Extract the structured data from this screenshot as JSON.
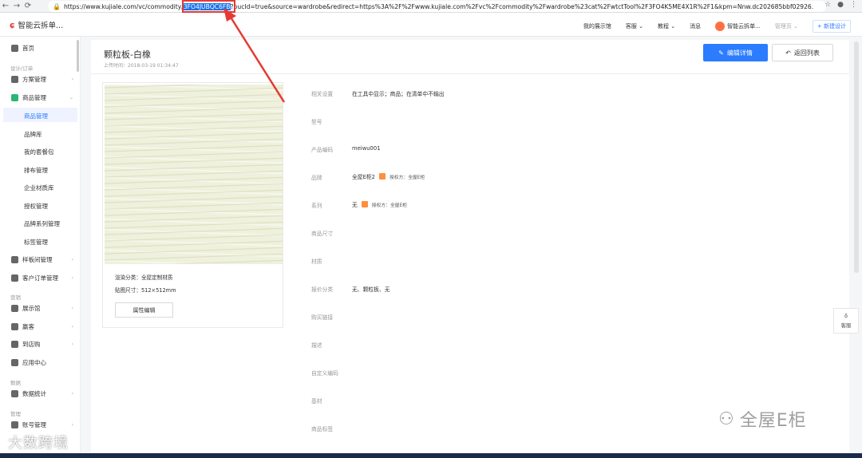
{
  "browser": {
    "url_prefix": "https://www.kujiale.com/vc/commodity/",
    "url_highlight": "3FO4JUBQC6FB",
    "url_suffix": "?bucId=true&source=wardrobe&redirect=https%3A%2F%2Fwww.kujiale.com%2Fvc%2Fcommodity%2Fwardrobe%23cat%2FwtctTool%2F3FO4K5ME4X1R%2F1&kpm=Nnw.dc202685bbf02926."
  },
  "header": {
    "app_name": "智能云拆单...",
    "nav": [
      "我的展示馆",
      "客服",
      "教程",
      "消息"
    ],
    "user_name": "智能云拆单...",
    "admin_page": "管理页",
    "new_design": "+ 新建设计"
  },
  "sidebar": {
    "home": "首页",
    "group_design": "设计/订单",
    "items": [
      "方案管理",
      "商品管理"
    ],
    "sub_items": [
      "商品管理",
      "品牌库",
      "我的套餐包",
      "排布管理",
      "企业材质库",
      "授权管理",
      "品牌系列管理",
      "标签管理"
    ],
    "items2": [
      "样板间管理",
      "客户订单管理"
    ],
    "group_marketing": "营销",
    "marketing_items": [
      "展示馆",
      "赢客",
      "到店购",
      "应用中心"
    ],
    "group_data": "数据",
    "data_items": [
      "数据统计"
    ],
    "group_manage": "管理",
    "manage_items": [
      "账号管理"
    ]
  },
  "main": {
    "title": "颗粒板-白橡",
    "upload_time": "上传时间：2018-03-19 01:34:47",
    "edit_button": "编辑详情",
    "back_button": "返回列表",
    "card": {
      "render_category": "渲染分类：全屋定制材质",
      "texture_size": "贴图尺寸：512×512mm",
      "attr_edit_button": "属性编辑"
    },
    "properties": [
      {
        "label": "相关设置",
        "value": "在工具中显示；商品；在清单中不输出"
      },
      {
        "label": "型号",
        "value": ""
      },
      {
        "label": "产品编码",
        "value": "meiwu001"
      },
      {
        "label": "品牌",
        "value": "全屋E柜2",
        "auth": "授权方：全屋E柜"
      },
      {
        "label": "系列",
        "value": "无",
        "auth": "授权方：全屋E柜"
      },
      {
        "label": "商品尺寸",
        "value": ""
      },
      {
        "label": "材质",
        "value": ""
      },
      {
        "label": "报价分类",
        "value": "无、颗粒板、无"
      },
      {
        "label": "购买链接",
        "value": ""
      },
      {
        "label": "描述",
        "value": ""
      },
      {
        "label": "自定义编码",
        "value": ""
      },
      {
        "label": "基材",
        "value": ""
      },
      {
        "label": "商品标签",
        "value": ""
      }
    ]
  },
  "service": {
    "label": "客服"
  },
  "watermarks": {
    "right": "全屋E柜",
    "left": "大数跨境"
  },
  "colors": {
    "primary": "#2b7cff",
    "highlight_border": "#e53935"
  }
}
